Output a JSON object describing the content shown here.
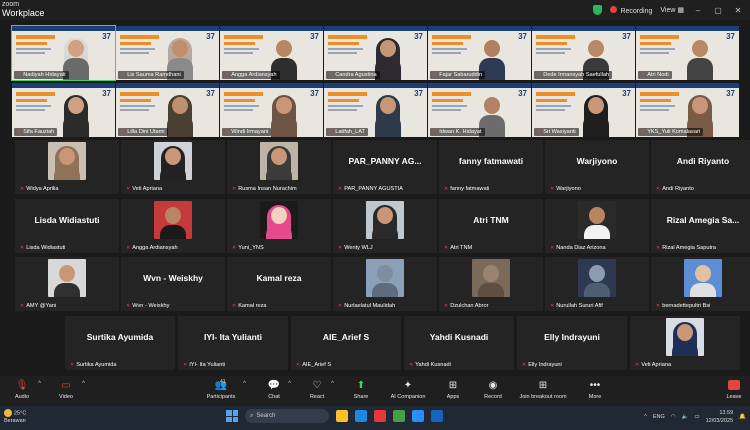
{
  "app": {
    "title_line1": "zoom",
    "title_line2": "Workplace"
  },
  "titlebar": {
    "recording_label": "Recording",
    "view_label": "View"
  },
  "rows": [
    {
      "tiles": [
        {
          "name": "Nadiyah Hidayati",
          "badge": "37",
          "skin": "#d2a07e",
          "hijab": "#d9d9d9",
          "body": "#6a6a6a",
          "active": true
        },
        {
          "name": "Lis Sauma Ramdhani",
          "badge": "37",
          "skin": "#c18f6e",
          "hijab": "#b8a9a0",
          "body": "#8a8a8a"
        },
        {
          "name": "Angga Ardiansyah",
          "badge": "37",
          "skin": "#b88663",
          "hijab": "",
          "body": "#2e2e2e"
        },
        {
          "name": "Candra Agustina",
          "badge": "37",
          "skin": "#c69777",
          "hijab": "#2e2a33",
          "body": "#2e2a33"
        },
        {
          "name": "Fajar Sabaruddin",
          "badge": "37",
          "skin": "#b0805f",
          "hijab": "",
          "body": "#2d3a54"
        },
        {
          "name": "Dede Irmansyah Saefullah",
          "badge": "37",
          "skin": "#b98865",
          "hijab": "",
          "body": "#3a3a3a"
        },
        {
          "name": "Atri Nodi",
          "badge": "37",
          "skin": "#b98865",
          "hijab": "",
          "body": "#444"
        }
      ]
    },
    {
      "tiles": [
        {
          "name": "Sifa Fauziah",
          "badge": "37",
          "skin": "#cfa081",
          "hijab": "#2b2b2b",
          "body": "#2b2b2b"
        },
        {
          "name": "Lilla Dini Utami",
          "badge": "37",
          "skin": "#c08f6d",
          "hijab": "#4a4032",
          "body": "#4a4032"
        },
        {
          "name": "Windi Irmayani",
          "badge": "37",
          "skin": "#c99777",
          "hijab": "#6e5443",
          "body": "#6e5443"
        },
        {
          "name": "Latifah_LAT",
          "badge": "37",
          "skin": "#c99777",
          "hijab": "#2c3a4a",
          "body": "#2c3a4a"
        },
        {
          "name": "Idwan K. Hidayat",
          "badge": "37",
          "skin": "#b38262",
          "hijab": "",
          "body": "#6b6b6b"
        },
        {
          "name": "Sri Wasiyanti",
          "badge": "37",
          "skin": "#c99777",
          "hijab": "#1e1e1e",
          "body": "#1e1e1e"
        },
        {
          "name": "YKS_Yuli Komalasari",
          "badge": "37",
          "skin": "#c99777",
          "hijab": "#7a5b45",
          "body": "#7a5b45"
        }
      ]
    },
    {
      "tiles": [
        {
          "name": "Widya Aprilia",
          "thumb": true,
          "skin": "#c99777",
          "hijab": "#8e7359",
          "body": "#8e7359",
          "bg": "#c9c0b2"
        },
        {
          "name": "Veti Apriana",
          "thumb": true,
          "skin": "#c99777",
          "hijab": "#222",
          "body": "#222",
          "bg": "#cfd2d6"
        },
        {
          "name": "Rusma Insan Nurachim",
          "thumb": true,
          "skin": "#c99777",
          "hijab": "#3b3b3b",
          "body": "#3b3b3b",
          "bg": "#bdb4a6"
        },
        {
          "name": "PAR_PANNY AGUSTIA",
          "big": "PAR_PANNY  AG..."
        },
        {
          "name": "fanny fatmawati",
          "big": "fanny fatmawati"
        },
        {
          "name": "Warjiyono",
          "big": "Warjiyono"
        },
        {
          "name": "Andi Riyanto",
          "big": "Andi Riyanto"
        }
      ]
    },
    {
      "tiles": [
        {
          "name": "Lisda Widiastuti",
          "big": "Lisda Widiastuti"
        },
        {
          "name": "Angga Ardiansyah",
          "thumb": true,
          "skin": "#b88663",
          "hijab": "",
          "body": "#1a1a1a",
          "bg": "#c53a3a"
        },
        {
          "name": "Yuni_YNS",
          "thumb": true,
          "skin": "#f3d3c0",
          "hijab": "#e54a8a",
          "body": "#e54a8a",
          "bg": "#1b1b1b"
        },
        {
          "name": "Wenty WLJ",
          "thumb": true,
          "skin": "#c99777",
          "hijab": "#2a2a2a",
          "body": "#2a2a2a",
          "bg": "#bfc7cf"
        },
        {
          "name": "Atri TNM",
          "big": "Atri TNM"
        },
        {
          "name": "Nanda Diaz Arizona",
          "thumb": true,
          "skin": "#b88663",
          "hijab": "",
          "body": "#f2f2f2",
          "bg": "#2a2a2a"
        },
        {
          "name": "Rizal Amegia Saputra",
          "big": "Rizal  Amegia  Sa..."
        }
      ]
    },
    {
      "tiles": [
        {
          "name": "AMY @Yani",
          "thumb": true,
          "skin": "#c99777",
          "hijab": "",
          "body": "#303030",
          "bg": "#d8d8d8"
        },
        {
          "name": "Wvn - Weiskhy",
          "big": "Wvn  -  Weiskhy"
        },
        {
          "name": "Kamal reza",
          "big": "Kamal reza"
        },
        {
          "name": "Nurlaelatul Maulidah",
          "thumb": true,
          "skin": "#7f8da0",
          "hijab": "",
          "body": "#5f6c7e",
          "bg": "#8aa0b8"
        },
        {
          "name": "Dzulchan Abror",
          "thumb": true,
          "skin": "#9a8470",
          "hijab": "",
          "body": "#5e4f42",
          "bg": "#7a6a5a"
        },
        {
          "name": "Nurullah Sururi Afif",
          "thumb": true,
          "skin": "#8c9bb0",
          "hijab": "",
          "body": "#4f5d70",
          "bg": "#2c3950"
        },
        {
          "name": "bernadettepultri Bsi",
          "thumb": true,
          "skin": "#e2c0a4",
          "hijab": "",
          "body": "#e0e0e0",
          "bg": "#5c8ed6"
        }
      ]
    },
    {
      "tiles": [
        {
          "name": "Surtika Ayumida",
          "big": "Surtika Ayumida"
        },
        {
          "name": "IYI- Ita Yulianti",
          "big": "IYI-  Ita Yulianti"
        },
        {
          "name": "AIE_Arief S",
          "big": "AIE_Arief S"
        },
        {
          "name": "Yahdi Kusnadi",
          "big": "Yahdi Kusnadi"
        },
        {
          "name": "Elly Indrayuni",
          "big": "Elly Indrayuni"
        },
        {
          "name": "Veti Apriana",
          "thumb": true,
          "skin": "#c99777",
          "hijab": "#1e2e55",
          "body": "#1e2e55",
          "bg": "#d8dde4"
        }
      ]
    }
  ],
  "toolbar": {
    "audio": "Audio",
    "video": "Video",
    "participants": "Participants",
    "participants_count": "41",
    "chat": "Chat",
    "react": "React",
    "share": "Share",
    "ai_companion": "AI Companion",
    "apps": "Apps",
    "record": "Record",
    "breakout": "Join breakout room",
    "more": "More",
    "leave": "Leave"
  },
  "taskbar": {
    "temp": "25°C",
    "weather": "Berawan",
    "search_placeholder": "Search",
    "lang": "ENG",
    "time": "13.59",
    "date": "12/03/2025"
  },
  "colors": {
    "accent": "#3bd26b",
    "danger": "#e0463d",
    "tile_bg": "#242424",
    "slide_blue": "#1c3e77",
    "slide_orange": "#e98f2c"
  }
}
